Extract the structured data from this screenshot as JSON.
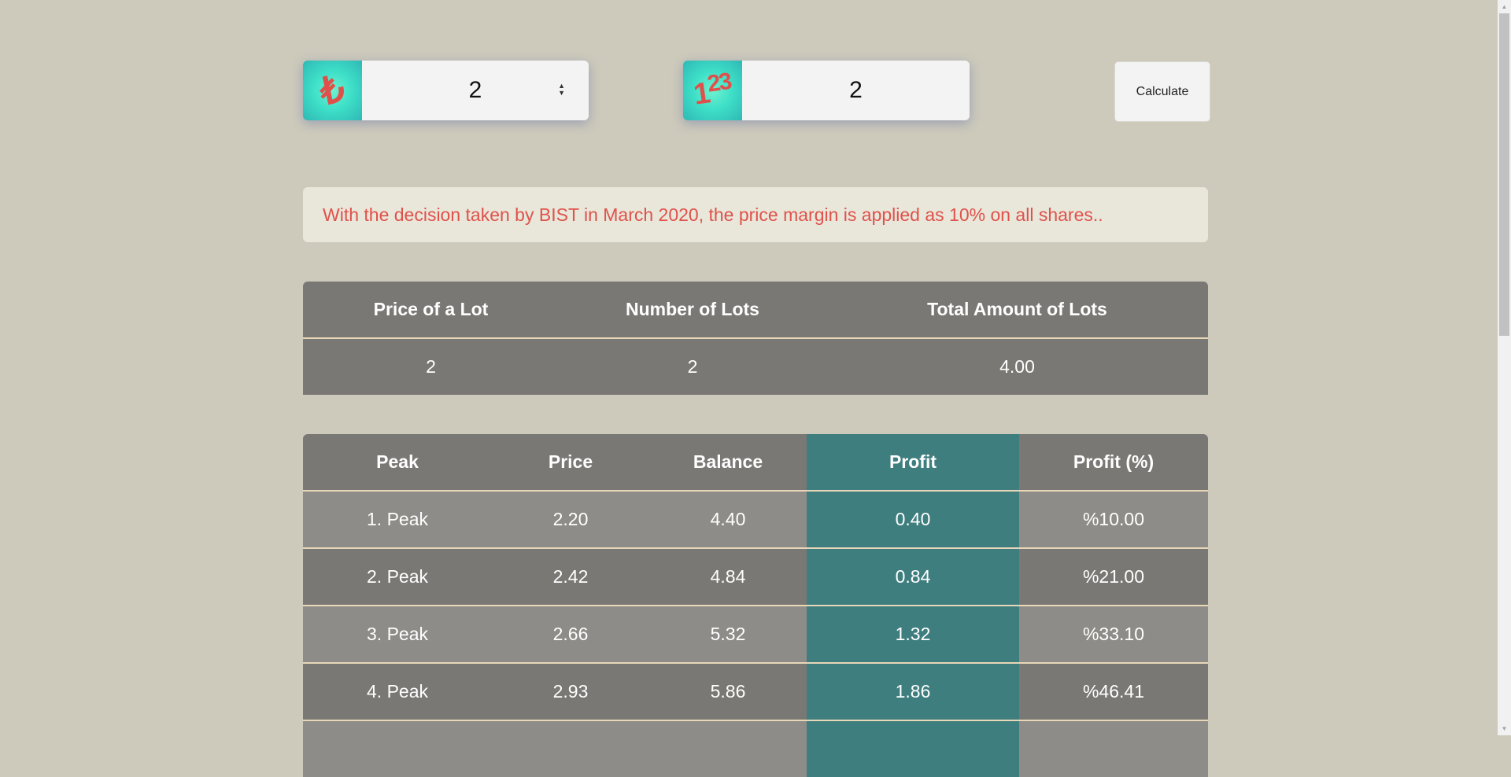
{
  "price_input": {
    "icon": "lira-icon",
    "value": "2"
  },
  "lots_input": {
    "icon": "numbers-icon",
    "value": "2"
  },
  "calculate_label": "Calculate",
  "notice": "With the decision taken by BIST in March 2020, the price margin is applied as 10% on all shares..",
  "summary_table": {
    "headers": [
      "Price of a Lot",
      "Number of Lots",
      "Total Amount of Lots"
    ],
    "row": [
      "2",
      "2",
      "4.00"
    ]
  },
  "peaks_table": {
    "headers": [
      "Peak",
      "Price",
      "Balance",
      "Profit",
      "Profit (%)"
    ],
    "rows": [
      [
        "1. Peak",
        "2.20",
        "4.40",
        "0.40",
        "%10.00"
      ],
      [
        "2. Peak",
        "2.42",
        "4.84",
        "0.84",
        "%21.00"
      ],
      [
        "3. Peak",
        "2.66",
        "5.32",
        "1.32",
        "%33.10"
      ],
      [
        "4. Peak",
        "2.93",
        "5.86",
        "1.86",
        "%46.41"
      ]
    ]
  },
  "colors": {
    "background": "#cdcabb",
    "table": "#7a7874",
    "profit_column": "#3f7e7f",
    "notice_text": "#e0524b",
    "icon_accent": "#3ee0c8"
  }
}
